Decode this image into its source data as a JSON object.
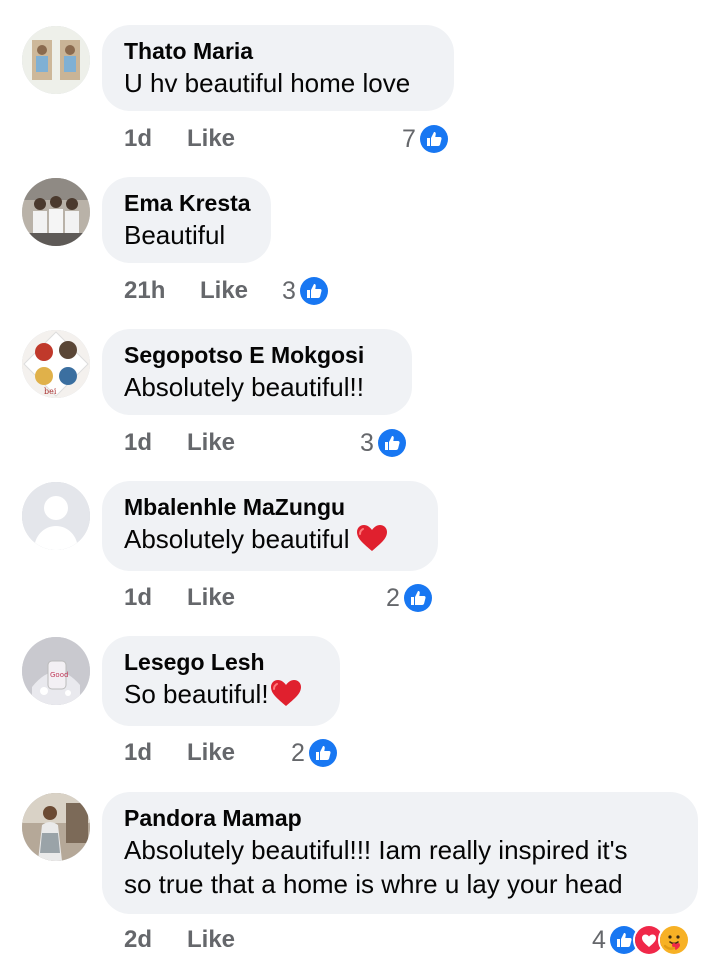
{
  "comments": [
    {
      "author": "Thato Maria",
      "text": "U hv beautiful home love",
      "time": "1d",
      "like_label": "Like",
      "reaction_count": "7",
      "reactions": [
        "like-icon"
      ],
      "avatar": "photo"
    },
    {
      "author": "Ema Kresta",
      "text": "Beautiful",
      "time": "21h",
      "like_label": "Like",
      "reaction_count": "3",
      "reactions": [
        "like-icon"
      ],
      "avatar": "photo"
    },
    {
      "author": "Segopotso E Mokgosi",
      "text": "Absolutely beautiful!!",
      "time": "1d",
      "like_label": "Like",
      "reaction_count": "3",
      "reactions": [
        "like-icon"
      ],
      "avatar": "photo"
    },
    {
      "author": "Mbalenhle MaZungu",
      "text": "Absolutely beautiful",
      "text_emoji": "heart-emoji",
      "time": "1d",
      "like_label": "Like",
      "reaction_count": "2",
      "reactions": [
        "like-icon"
      ],
      "avatar": "default-silhouette"
    },
    {
      "author": "Lesego Lesh",
      "text": "So beautiful!",
      "text_emoji": "heart-emoji",
      "time": "1d",
      "like_label": "Like",
      "reaction_count": "2",
      "reactions": [
        "like-icon"
      ],
      "avatar": "photo"
    },
    {
      "author": "Pandora Mamap",
      "text_lines": [
        "Absolutely beautiful!!! Iam really inspired  it's",
        "so true that a home is whre u lay your head"
      ],
      "time": "2d",
      "like_label": "Like",
      "reaction_count": "4",
      "reactions": [
        "like-icon",
        "love-icon",
        "care-icon"
      ],
      "avatar": "photo"
    }
  ],
  "colors": {
    "bubble": "#f0f2f5",
    "like_blue": "#1877f2",
    "love_red": "#f02849",
    "meta_gray": "#65676b",
    "care_yellow": "#f7b125"
  }
}
